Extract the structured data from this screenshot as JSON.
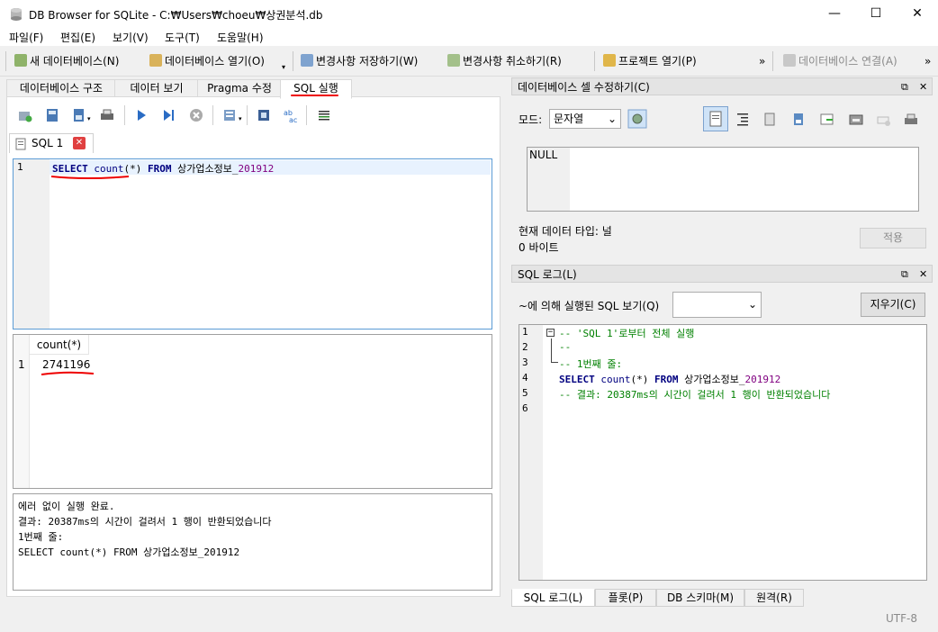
{
  "window": {
    "title": "DB Browser for SQLite - C:₩Users₩choeu₩상권분석.db",
    "controls": {
      "minimize": "—",
      "maximize": "☐",
      "close": "✕"
    }
  },
  "menu": [
    "파일(F)",
    "편집(E)",
    "보기(V)",
    "도구(T)",
    "도움말(H)"
  ],
  "toolbar": {
    "new_db": "새 데이터베이스(N)",
    "open_db": "데이터베이스 열기(O)",
    "write_changes": "변경사항 저장하기(W)",
    "revert_changes": "변경사항 취소하기(R)",
    "open_project": "프로젝트 열기(P)",
    "attach_db": "데이터베이스 연결(A)",
    "more": "»"
  },
  "left_tabs": [
    "데이터베이스 구조",
    "데이터 보기",
    "Pragma 수정",
    "SQL 실행"
  ],
  "sql_tab": {
    "label": "SQL 1"
  },
  "editor": {
    "line_number": "1",
    "query": {
      "select": "SELECT",
      "count": "count",
      "args": "(*)",
      "from": "FROM",
      "table": "상가업소정보_",
      "table_suffix": "201912"
    }
  },
  "results": {
    "column": "count(*)",
    "row_number": "1",
    "value": "2741196"
  },
  "message": {
    "lines": [
      "에러 없이 실행 완료.",
      "결과: 20387ms의 시간이 걸려서 1 행이 반환되었습니다",
      "1번째 줄:",
      "SELECT count(*) FROM 상가업소정보_201912"
    ]
  },
  "edit_cell": {
    "title": "데이터베이스 셀 수정하기(C)",
    "mode_label": "모드:",
    "mode_value": "문자열",
    "cell_value": "NULL",
    "type_label": "현재 데이터 타입: 널",
    "size_label": "0 바이트",
    "apply_button": "적용"
  },
  "sql_log": {
    "title": "SQL 로그(L)",
    "filter_label": "~에 의해 실행된 SQL 보기(Q)",
    "clear_button": "지우기(C)",
    "line_numbers": [
      "1",
      "2",
      "3",
      "4",
      "5",
      "6"
    ],
    "lines": [
      "-- 'SQL 1'로부터 전체 실행",
      "--",
      "-- 1번째 줄:",
      "",
      "-- 결과: 20387ms의 시간이 걸려서 1 행이 반환되었습니다",
      ""
    ],
    "query": {
      "select": "SELECT",
      "count": "count",
      "args": "(*)",
      "from": "FROM",
      "table": "상가업소정보_",
      "table_suffix": "201912"
    }
  },
  "bottom_tabs": [
    "SQL 로그(L)",
    "플롯(P)",
    "DB 스키마(M)",
    "원격(R)"
  ],
  "status": {
    "encoding": "UTF-8"
  },
  "colors": {
    "accent_blue": "#5b9bd5",
    "annotation_red": "#e00000",
    "keyword": "#000080",
    "comment": "#008000"
  }
}
